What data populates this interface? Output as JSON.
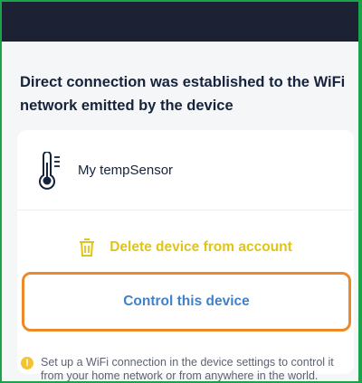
{
  "header": {
    "title": "Direct connection was established to the WiFi network emitted by the device"
  },
  "device": {
    "name": "My tempSensor",
    "icon": "thermometer-icon"
  },
  "actions": {
    "delete_label": "Delete device from account",
    "delete_icon": "trash-icon",
    "control_label": "Control this device"
  },
  "notice": {
    "icon": "info-icon",
    "glyph": "!",
    "text": "Set up a WiFi connection in the device settings to control it from your home network or from anywhere in the world."
  },
  "colors": {
    "top_bar": "#1c2233",
    "delete": "#e0c418",
    "control": "#3f82c8",
    "highlight_border": "#ec8a2a",
    "notice_icon": "#f4c430"
  }
}
